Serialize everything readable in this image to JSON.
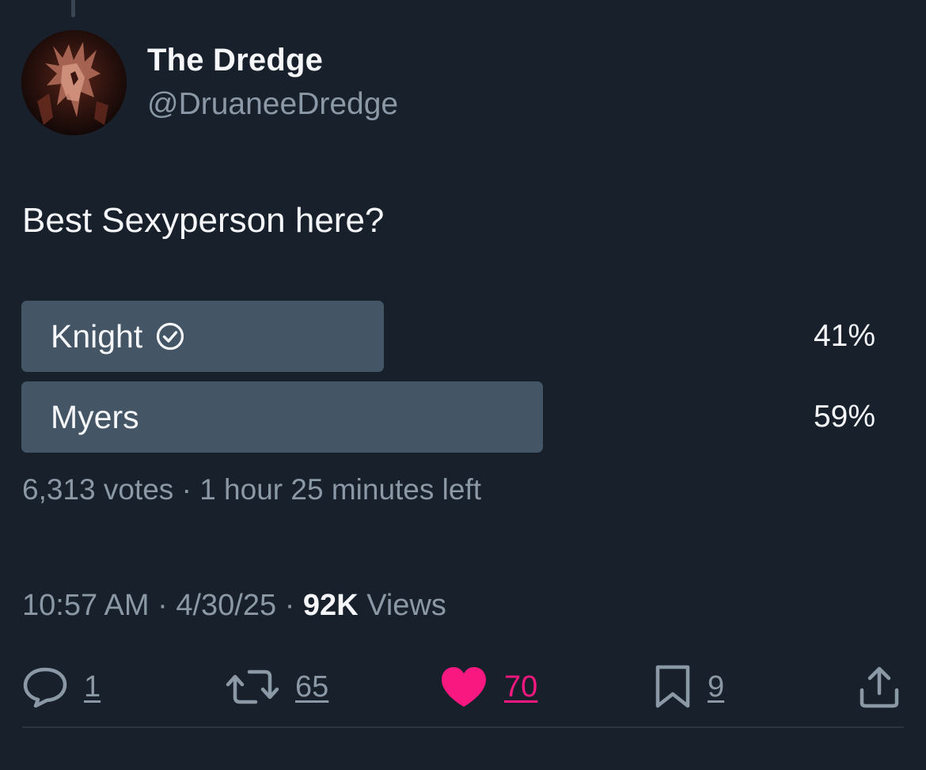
{
  "author": {
    "display_name": "The Dredge",
    "handle": "@DruaneeDredge",
    "avatar_icon": "dredge-monster-avatar"
  },
  "post": {
    "text": "Best Sexyperson here?"
  },
  "poll": {
    "options": [
      {
        "label": "Knight",
        "percent_text": "41%",
        "percent": 41,
        "selected": true,
        "check_icon": "check-circle-icon"
      },
      {
        "label": "Myers",
        "percent_text": "59%",
        "percent": 59,
        "selected": false
      }
    ],
    "votes": "6,313 votes",
    "separator": "·",
    "time_left": "1 hour 25 minutes left"
  },
  "meta": {
    "time": "10:57 AM",
    "date": "4/30/25",
    "views_count": "92K",
    "views_label": "Views",
    "separator": "·"
  },
  "actions": {
    "reply": {
      "icon": "reply-bubble-icon",
      "count": "1"
    },
    "repost": {
      "icon": "repost-icon",
      "count": "65"
    },
    "like": {
      "icon": "heart-icon",
      "count": "70",
      "color": "#f91880",
      "liked": true
    },
    "bookmark": {
      "icon": "bookmark-icon",
      "count": "9"
    },
    "share": {
      "icon": "share-icon"
    }
  },
  "colors": {
    "background": "#18202b",
    "poll_bar": "#445566",
    "secondary_text": "#8b98a5",
    "like": "#f91880"
  }
}
